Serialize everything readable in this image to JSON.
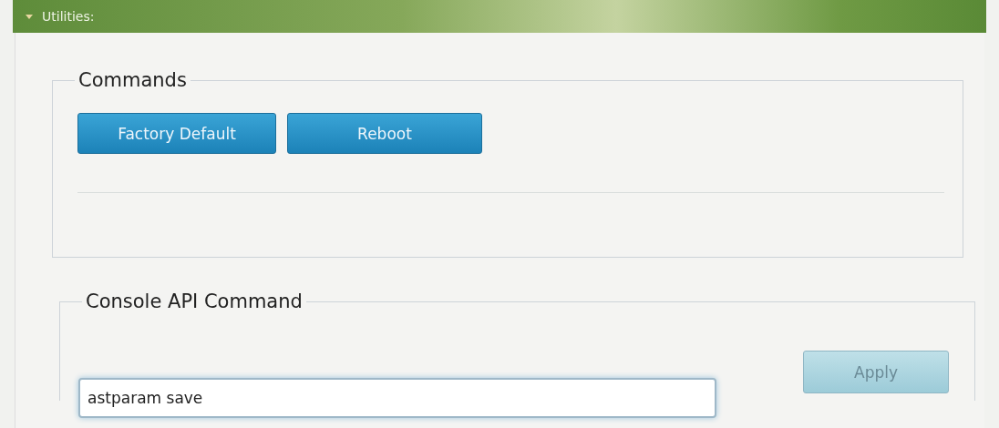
{
  "panel": {
    "title": "Utilities:",
    "expanded": true
  },
  "commands": {
    "legend": "Commands",
    "buttons": [
      "Factory Default",
      "Reboot"
    ]
  },
  "console": {
    "legend": "Console API Command",
    "value": "astparam save",
    "button": "Apply"
  }
}
